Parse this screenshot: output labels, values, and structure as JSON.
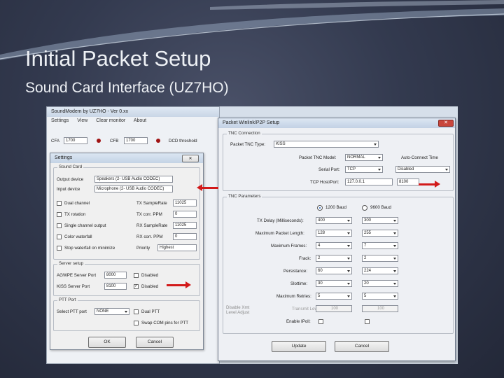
{
  "slide": {
    "title": "Initial Packet Setup",
    "subtitle": "Sound Card Interface (UZ7HO)"
  },
  "soundmodem": {
    "title": "SoundModem by UZ7HO - Ver 0.xx",
    "menu": [
      "Settings",
      "View",
      "Clear monitor",
      "About"
    ],
    "cfa_label": "CFA",
    "cfa_value": "1700",
    "cfb_label": "CFB",
    "cfb_value": "1700",
    "dcd_label": "DCD threshold"
  },
  "settings": {
    "title": "Settings",
    "close": "✕",
    "sound_card_group": "Sound Card",
    "output_device_label": "Output device",
    "output_device_value": "Speakers (2- USB Audio CODEC)",
    "input_device_label": "Input device",
    "input_device_value": "Microphone (2- USB Audio CODEC)",
    "checks": [
      "Dual channel",
      "TX rotation",
      "Single channel output",
      "Color waterfall",
      "Stop waterfall on minimize"
    ],
    "rates": [
      {
        "label": "TX SampleRate",
        "value": "11025"
      },
      {
        "label": "TX corr. PPM",
        "value": "0"
      },
      {
        "label": "RX SampleRate",
        "value": "11025"
      },
      {
        "label": "RX corr. PPM",
        "value": "0"
      }
    ],
    "priority_label": "Priority",
    "priority_value": "Highest",
    "server_group": "Server setup",
    "agw_label": "AGWPE Server Port",
    "agw_value": "8000",
    "agw_disabled": "Disabled",
    "kiss_label": "KISS Server Port",
    "kiss_value": "8100",
    "kiss_disabled": "Disabled",
    "ptt_group": "PTT Port",
    "ptt_select_label": "Select PTT port",
    "ptt_select_value": "NONE",
    "dual_ptt": "Dual PTT",
    "swap_com": "Swap COM pins for PTT",
    "ok": "OK",
    "cancel": "Cancel"
  },
  "winlink": {
    "title": "Packet Winlink/P2P Setup",
    "tnc_connection_group": "TNC Connection",
    "tnc_type_label": "Packet TNC Type:",
    "tnc_type_value": "KISS",
    "tnc_model_label": "Packet TNC Model:",
    "tnc_model_value": "NORMAL",
    "serial_port_label": "Serial Port:",
    "serial_port_value": "TCP",
    "host_label": "TCP Host/Port:",
    "host_value": "127.0.0.1",
    "port_value": "8100",
    "autoconnect_label": "Auto-Connect Time",
    "autoconnect_value": "Disabled",
    "tnc_params_group": "TNC Parameters",
    "baud1200": "1200 Baud",
    "baud9600": "9600 Baud",
    "params": [
      {
        "label": "TX Delay (Milliseconds):",
        "v1": "400",
        "v2": "300"
      },
      {
        "label": "Maximum Packet Length:",
        "v1": "128",
        "v2": "255"
      },
      {
        "label": "Maximum Frames:",
        "v1": "4",
        "v2": "7"
      },
      {
        "label": "Frack:",
        "v1": "2",
        "v2": "2"
      },
      {
        "label": "Persistance:",
        "v1": "60",
        "v2": "224"
      },
      {
        "label": "Slottime:",
        "v1": "30",
        "v2": "20"
      },
      {
        "label": "Maximum Retries:",
        "v1": "5",
        "v2": "5"
      }
    ],
    "disable_xmt_label": "Disable Xmt Level Adjust",
    "xmt_label": "Transmit Level:",
    "xmt_v1": "100",
    "xmt_v2": "100",
    "enable_ipoll": "Enable IPoll:",
    "update": "Update",
    "cancel": "Cancel"
  },
  "colors": {
    "arrow": "#d21a1a",
    "background": "#333a4f"
  }
}
